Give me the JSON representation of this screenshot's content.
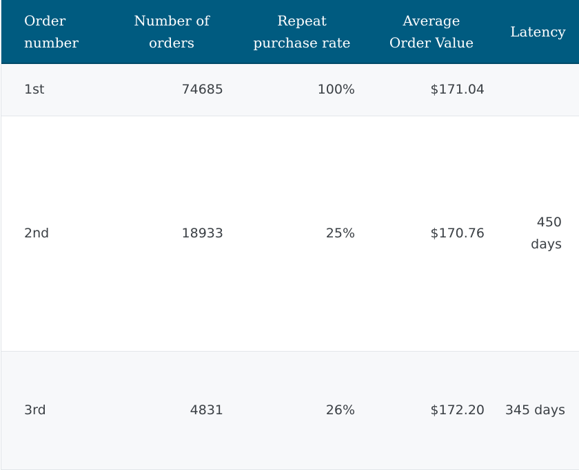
{
  "table": {
    "header_color": "#005b80",
    "columns": [
      {
        "label": "Order number"
      },
      {
        "label": "Number of orders"
      },
      {
        "label": "Repeat purchase rate"
      },
      {
        "label": "Average Order Value"
      },
      {
        "label": "Latency"
      }
    ],
    "header_lines": [
      [
        "Order",
        "number"
      ],
      [
        "Number of",
        "orders"
      ],
      [
        "Repeat",
        "purchase rate"
      ],
      [
        "Average",
        "Order Value"
      ],
      [
        "Latency"
      ]
    ],
    "rows": [
      {
        "order_number": "1st",
        "number_of_orders": "74685",
        "repeat_purchase_rate": "100%",
        "average_order_value": "$171.04",
        "latency": ""
      },
      {
        "order_number": "2nd",
        "number_of_orders": "18933",
        "repeat_purchase_rate": "25%",
        "average_order_value": "$170.76",
        "latency": "450 days"
      },
      {
        "order_number": "3rd",
        "number_of_orders": "4831",
        "repeat_purchase_rate": "26%",
        "average_order_value": "$172.20",
        "latency": "345 days"
      }
    ]
  }
}
